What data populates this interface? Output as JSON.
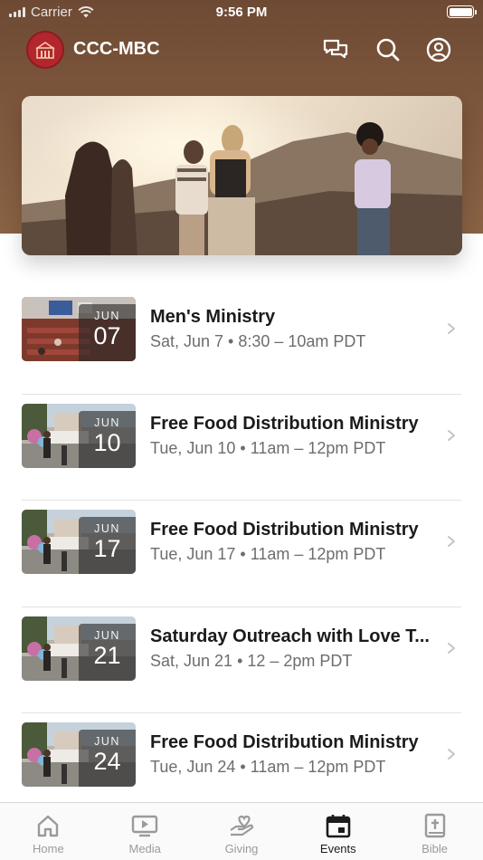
{
  "status_bar": {
    "carrier": "Carrier",
    "time": "9:56 PM"
  },
  "header": {
    "title": "CCC-MBC"
  },
  "nav_icons": [
    "chat-icon",
    "search-icon",
    "profile-icon"
  ],
  "events": [
    {
      "title": "Men's Ministry",
      "month": "JUN",
      "day": "07",
      "meta": "Sat, Jun 7 • 8:30 – 10am PDT",
      "thumb": "church-interior"
    },
    {
      "title": "Free Food Distribution Ministry",
      "month": "JUN",
      "day": "10",
      "meta": "Tue, Jun 10 • 11am – 12pm PDT",
      "thumb": "outdoor-food"
    },
    {
      "title": "Free Food Distribution Ministry",
      "month": "JUN",
      "day": "17",
      "meta": "Tue, Jun 17 • 11am – 12pm PDT",
      "thumb": "outdoor-food"
    },
    {
      "title": "Saturday Outreach with Love T...",
      "month": "JUN",
      "day": "21",
      "meta": "Sat, Jun 21 • 12 – 2pm PDT",
      "thumb": "outdoor-food"
    },
    {
      "title": "Free Food Distribution Ministry",
      "month": "JUN",
      "day": "24",
      "meta": "Tue, Jun 24 • 11am – 12pm PDT",
      "thumb": "outdoor-food"
    }
  ],
  "tabs": [
    {
      "label": "Home",
      "icon": "home-icon",
      "active": false
    },
    {
      "label": "Media",
      "icon": "media-icon",
      "active": false
    },
    {
      "label": "Giving",
      "icon": "giving-icon",
      "active": false
    },
    {
      "label": "Events",
      "icon": "calendar-icon",
      "active": true
    },
    {
      "label": "Bible",
      "icon": "bible-icon",
      "active": false
    }
  ],
  "colors": {
    "header": "#7d563c",
    "logo": "#b3262d",
    "active_tab": "#1b1b1b",
    "inactive_tab": "#9a9a9a"
  }
}
